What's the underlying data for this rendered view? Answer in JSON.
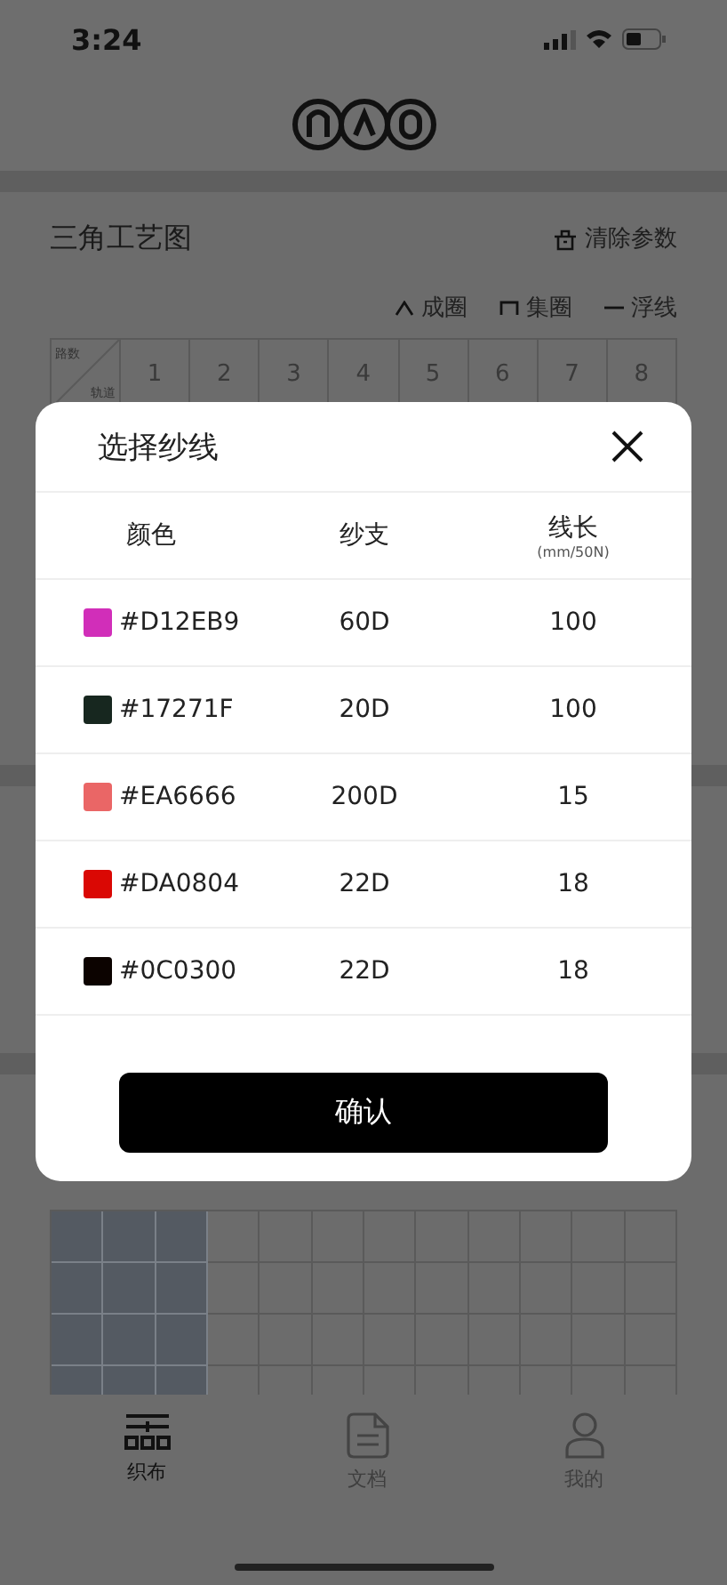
{
  "status_bar": {
    "time": "3:24"
  },
  "card": {
    "title": "三角工艺图",
    "clear_button": "清除参数",
    "legend": [
      {
        "kind": "loop",
        "label": "成圈"
      },
      {
        "kind": "tuck",
        "label": "集圈"
      },
      {
        "kind": "float",
        "label": "浮线"
      }
    ],
    "table": {
      "corner_top": "路数",
      "corner_bottom": "轨道",
      "columns": [
        "1",
        "2",
        "3",
        "4",
        "5",
        "6",
        "7",
        "8"
      ]
    }
  },
  "grid": [
    [
      {
        "selected": true
      },
      {
        "selected": true
      },
      {
        "selected": true
      },
      {
        "selected": false
      },
      {
        "selected": false
      },
      {
        "selected": false
      },
      {
        "selected": false
      },
      {
        "selected": false
      },
      {
        "selected": false
      },
      {
        "selected": false
      },
      {
        "selected": false
      },
      {
        "selected": false
      }
    ],
    [
      {
        "selected": true
      },
      {
        "selected": true
      },
      {
        "selected": true
      },
      {
        "selected": false
      },
      {
        "selected": false
      },
      {
        "selected": false
      },
      {
        "selected": false
      },
      {
        "selected": false
      },
      {
        "selected": false
      },
      {
        "selected": false
      },
      {
        "selected": false
      },
      {
        "selected": false
      }
    ],
    [
      {
        "selected": true
      },
      {
        "selected": true
      },
      {
        "selected": true
      },
      {
        "selected": false
      },
      {
        "selected": false
      },
      {
        "selected": false
      },
      {
        "selected": false
      },
      {
        "selected": false
      },
      {
        "selected": false
      },
      {
        "selected": false
      },
      {
        "selected": false
      },
      {
        "selected": false
      }
    ],
    [
      {
        "selected": true
      },
      {
        "selected": true
      },
      {
        "selected": true
      },
      {
        "selected": false
      },
      {
        "selected": false
      },
      {
        "selected": false
      },
      {
        "selected": false
      },
      {
        "selected": false
      },
      {
        "selected": false
      },
      {
        "selected": false
      },
      {
        "selected": false
      },
      {
        "selected": false
      }
    ]
  ],
  "tab_bar": [
    {
      "kind": "weave",
      "label": "织布",
      "selected": true
    },
    {
      "kind": "document",
      "label": "文档",
      "selected": false
    },
    {
      "kind": "profile",
      "label": "我的",
      "selected": false
    }
  ],
  "dialog": {
    "title": "选择纱线",
    "columns": [
      {
        "label": "颜色"
      },
      {
        "label": "纱支"
      },
      {
        "label": "线长",
        "unit": "(mm/50N)"
      }
    ],
    "rows": [
      {
        "color": "#d12eb9",
        "hex": "#D12EB9",
        "count": "60D",
        "length": "100"
      },
      {
        "color": "#17271f",
        "hex": "#17271F",
        "count": "20D",
        "length": "100"
      },
      {
        "color": "#ea6666",
        "hex": "#EA6666",
        "count": "200D",
        "length": "15"
      },
      {
        "color": "#da0804",
        "hex": "#DA0804",
        "count": "22D",
        "length": "18"
      },
      {
        "color": "#0c0300",
        "hex": "#0C0300",
        "count": "22D",
        "length": "18"
      }
    ],
    "confirm": "确认"
  }
}
